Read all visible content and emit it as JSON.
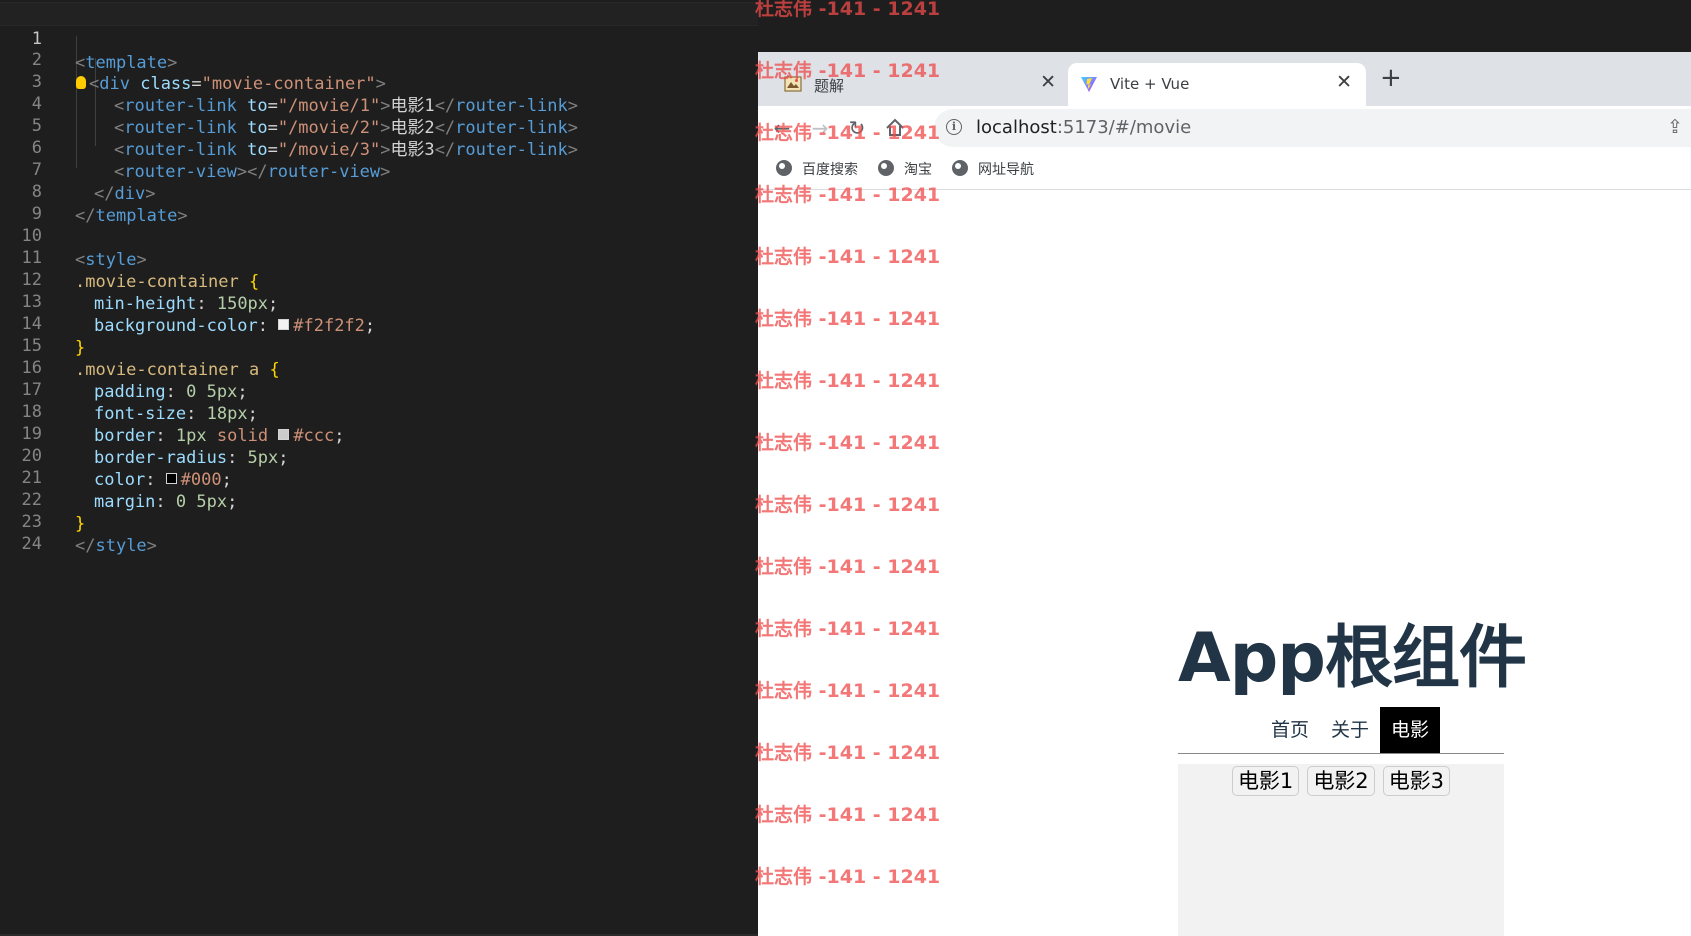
{
  "editor": {
    "lines": [
      {
        "n": "1"
      },
      {
        "n": "2"
      },
      {
        "n": "3"
      },
      {
        "n": "4"
      },
      {
        "n": "5"
      },
      {
        "n": "6"
      },
      {
        "n": "7"
      },
      {
        "n": "8"
      },
      {
        "n": "9"
      },
      {
        "n": "10"
      },
      {
        "n": "11"
      },
      {
        "n": "12"
      },
      {
        "n": "13"
      },
      {
        "n": "14"
      },
      {
        "n": "15"
      },
      {
        "n": "16"
      },
      {
        "n": "17"
      },
      {
        "n": "18"
      },
      {
        "n": "19"
      },
      {
        "n": "20"
      },
      {
        "n": "21"
      },
      {
        "n": "22"
      },
      {
        "n": "23"
      },
      {
        "n": "24"
      }
    ],
    "code": {
      "l1_tag": "template",
      "l2_tag": "div",
      "l2_attr": "class",
      "l2_val": "\"movie-container\"",
      "l3_tag": "router-link",
      "l3_attr": "to",
      "l3_val": "\"/movie/1\"",
      "l3_text": "电影1",
      "l4_tag": "router-link",
      "l4_attr": "to",
      "l4_val": "\"/movie/2\"",
      "l4_text": "电影2",
      "l5_tag": "router-link",
      "l5_attr": "to",
      "l5_val": "\"/movie/3\"",
      "l5_text": "电影3",
      "l6_tag": "router-view",
      "l7_tag": "div",
      "l8_tag": "template",
      "l10_tag": "style",
      "l11_sel": ".movie-container",
      "l12_prop": "min-height",
      "l12_val": "150px",
      "l13_prop": "background-color",
      "l13_val": "#f2f2f2",
      "l15_sel": ".movie-container a",
      "l16_prop": "padding",
      "l16_val": "0 5px",
      "l17_prop": "font-size",
      "l17_val": "18px",
      "l18_prop": "border",
      "l18_val1": "1px",
      "l18_val2": "solid",
      "l18_val3": "#ccc",
      "l19_prop": "border-radius",
      "l19_val": "5px",
      "l20_prop": "color",
      "l20_val": "#000",
      "l21_prop": "margin",
      "l21_val": "0 5px",
      "l23_tag": "style"
    },
    "swatches": {
      "bg": "#f2f2f2",
      "border": "#ccc",
      "color": "#000"
    }
  },
  "browser": {
    "tabs": [
      {
        "title": "题解",
        "icon": "painting-favicon-icon"
      },
      {
        "title": "Vite + Vue",
        "icon": "vite-logo-icon"
      }
    ],
    "url_host": "localhost",
    "url_rest": ":5173/#/movie",
    "bookmarks": [
      "百度搜索",
      "淘宝",
      "网址导航"
    ]
  },
  "page": {
    "title": "App根组件",
    "nav": [
      "首页",
      "关于",
      "电影"
    ],
    "movies": [
      "电影1",
      "电影2",
      "电影3"
    ]
  },
  "watermark": "杜志伟 -141 - 1241",
  "colors": {
    "accent": "#213547",
    "watermark": "#ef4a4a"
  }
}
